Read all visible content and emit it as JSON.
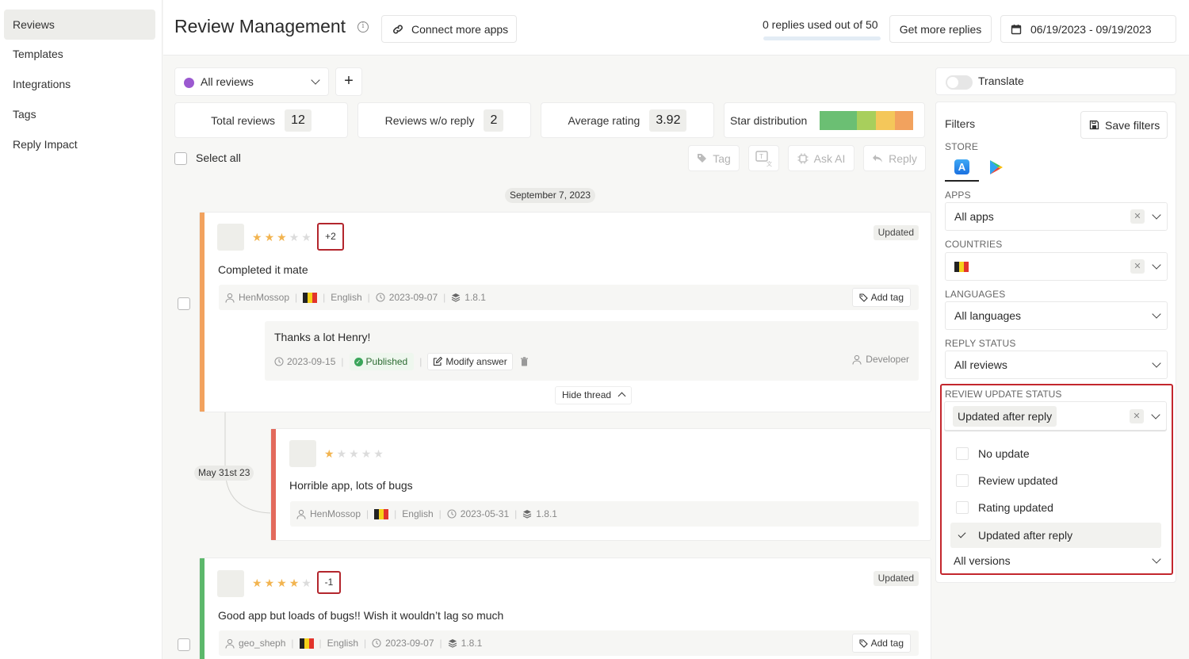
{
  "sidebar": {
    "items": [
      {
        "label": "Reviews",
        "active": true
      },
      {
        "label": "Templates"
      },
      {
        "label": "Integrations"
      },
      {
        "label": "Tags"
      },
      {
        "label": "Reply Impact"
      }
    ]
  },
  "header": {
    "title": "Review Management",
    "connect_label": "Connect more apps",
    "replies_used": "0 replies used out of 50",
    "replies_progress": 0,
    "get_more_label": "Get more replies",
    "date_range": "06/19/2023 - 09/19/2023"
  },
  "toolbar": {
    "review_filter": "All reviews",
    "review_filter_color": "#9b59d0",
    "add_label": "+",
    "translate_label": "Translate",
    "select_all_label": "Select all",
    "tag_label": "Tag",
    "ask_ai_label": "Ask AI",
    "reply_label": "Reply"
  },
  "stats": {
    "total_label": "Total reviews",
    "total_value": "12",
    "noreply_label": "Reviews w/o reply",
    "noreply_value": "2",
    "avg_label": "Average rating",
    "avg_value": "3.92",
    "dist_label": "Star distribution",
    "dist_colors": [
      "#6bbf73",
      "#6bbf73",
      "#a8cf5c",
      "#f4c75a",
      "#f2a25e"
    ]
  },
  "feed": {
    "date_chip": "September 7, 2023",
    "thread_chip": "May 31st 23",
    "reviews": [
      {
        "bar_color": "#f2a25e",
        "rating": 3,
        "delta": "+2",
        "status": "Updated",
        "text": "Completed it mate",
        "author": "HenMossop",
        "language": "English",
        "date": "2023-09-07",
        "version": "1.8.1",
        "add_tag": "Add tag",
        "reply": {
          "text": "Thanks a lot Henry!",
          "date": "2023-09-15",
          "status": "Published",
          "modify_label": "Modify answer",
          "author": "Developer"
        },
        "hide_thread": "Hide thread"
      },
      {
        "bar_color": "#e36a5c",
        "rating": 1,
        "text": "Horrible app, lots of bugs",
        "author": "HenMossop",
        "language": "English",
        "date": "2023-05-31",
        "version": "1.8.1"
      },
      {
        "bar_color": "#5cb86b",
        "rating": 4,
        "delta": "-1",
        "status": "Updated",
        "text": "Good app but loads of bugs!! Wish it wouldn’t lag so much",
        "author": "geo_sheph",
        "language": "English",
        "date": "2023-09-07",
        "version": "1.8.1",
        "add_tag": "Add tag"
      }
    ]
  },
  "filters": {
    "title": "Filters",
    "save_label": "Save filters",
    "store_label": "STORE",
    "apps_label": "APPS",
    "apps_value": "All apps",
    "countries_label": "COUNTRIES",
    "languages_label": "LANGUAGES",
    "languages_value": "All languages",
    "reply_status_label": "REPLY STATUS",
    "reply_status_value": "All reviews",
    "update_status_label": "REVIEW UPDATE STATUS",
    "update_status_value": "Updated after reply",
    "update_options": [
      {
        "label": "No update",
        "selected": false
      },
      {
        "label": "Review updated",
        "selected": false
      },
      {
        "label": "Rating updated",
        "selected": false
      },
      {
        "label": "Updated after reply",
        "selected": true
      }
    ],
    "versions_value": "All versions",
    "highlight_color": "#c3262d"
  }
}
